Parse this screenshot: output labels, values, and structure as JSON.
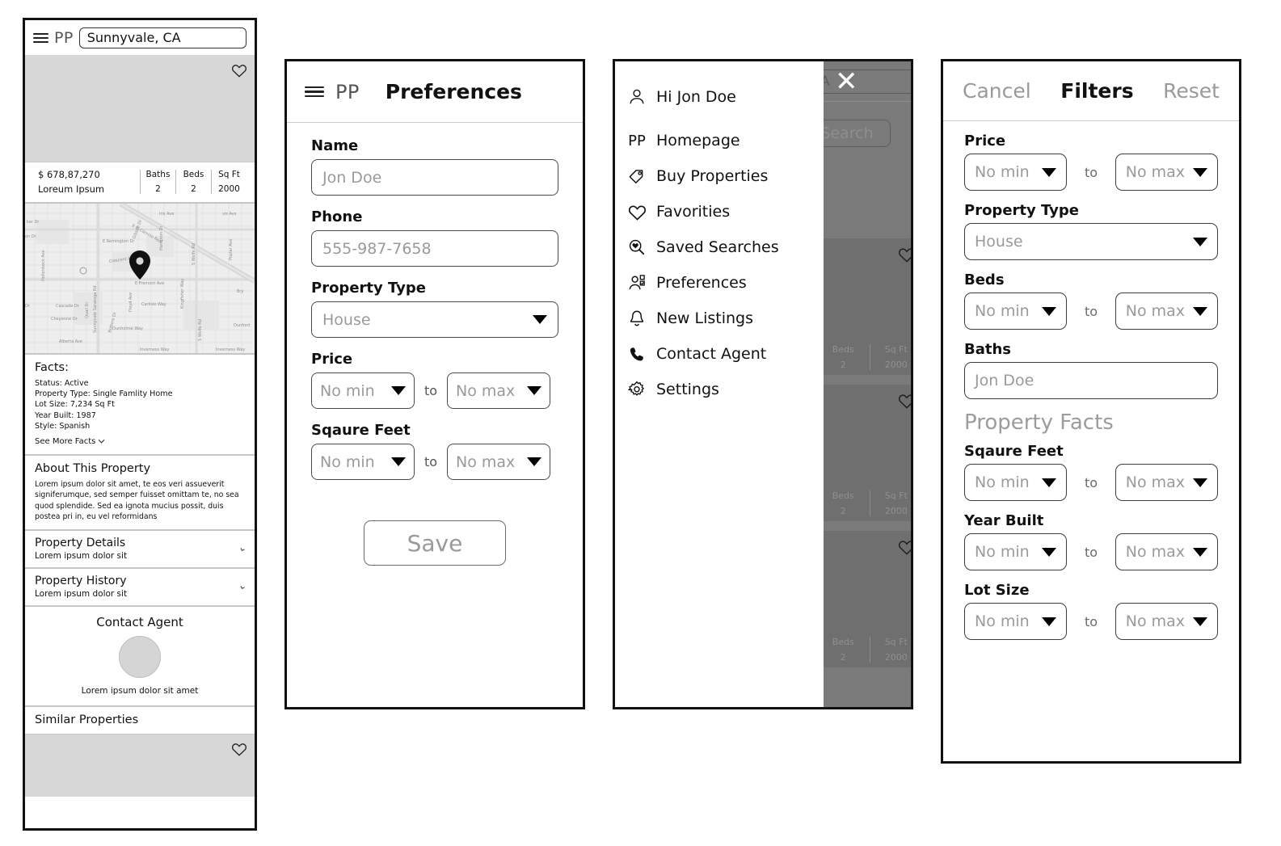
{
  "detail_panel": {
    "topbar": {
      "menu_icon": "hamburger-icon",
      "logo": "PP",
      "location_value": "Sunnyvale, CA"
    },
    "hero": {
      "favorite_icon": "heart-icon"
    },
    "listing": {
      "price": "$ 678,87,270",
      "subtitle": "Loreum Ipsum",
      "stats": [
        {
          "label": "Baths",
          "value": "2"
        },
        {
          "label": "Beds",
          "value": "2"
        },
        {
          "label": "Sq Ft",
          "value": "2000"
        }
      ]
    },
    "map": {
      "pin_icon": "map-pin-icon",
      "street_labels": [
        "E El Camino Real",
        "E Remington Dr",
        "E Fremont Ave",
        "Crescent Ave",
        "Sunnyvale Saratoga Rd",
        "Hollenbeck Ave",
        "S Wolfe Rd",
        "Cascade Dr",
        "Cheyenne Dr",
        "Alberta Ave",
        "Dunholme Way",
        "Carlisle Way",
        "Inverness Way",
        "Kingfisher Way",
        "Floyd Ave",
        "Poplar Ave",
        "Iris Ave",
        "Bottera Dr",
        "Hampton Dr",
        "Dunford Way",
        "Quail Dr"
      ]
    },
    "facts": {
      "heading": "Facts:",
      "lines": [
        "Status: Active",
        "Property Type: Single Famlity Home",
        "Lot Size:  7,234 Sq Ft",
        "Year Built: 1987",
        "Style: Spanish"
      ],
      "see_more": "See More Facts",
      "see_more_icon": "chevron-down-icon"
    },
    "about": {
      "heading": "About This Property",
      "body": "Lorem ipsum dolor sit amet, te eos veri assueverit signiferumque, sed semper fuisset omittam te, no sea quod splendide. Sed ea ignota mucius possit, duis postea pri in, eu vel reformidans"
    },
    "accordions": [
      {
        "title": "Property Details",
        "sub": "Lorem ipsum dolor sit",
        "icon": "chevron-right-icon"
      },
      {
        "title": "Property History",
        "sub": "Lorem ipsum dolor sit",
        "icon": "chevron-right-icon"
      }
    ],
    "agent": {
      "heading": "Contact Agent",
      "avatar_icon": "avatar-placeholder",
      "caption": "Lorem ipsum dolor sit amet"
    },
    "similar": {
      "heading": "Similar Properties",
      "favorite_icon": "heart-icon"
    }
  },
  "preferences_panel": {
    "topbar": {
      "menu_icon": "hamburger-icon",
      "logo": "PP",
      "title": "Preferences"
    },
    "fields": [
      {
        "label": "Name",
        "placeholder": "Jon Doe",
        "type": "text"
      },
      {
        "label": "Phone",
        "placeholder": "555-987-7658",
        "type": "text"
      },
      {
        "label": "Property Type",
        "value": "House",
        "type": "select"
      }
    ],
    "ranges": [
      {
        "label": "Price",
        "min": "No min",
        "max": "No max",
        "sep": "to"
      },
      {
        "label": "Sqaure Feet",
        "min": "No min",
        "max": "No max",
        "sep": "to"
      }
    ],
    "save_label": "Save"
  },
  "menu_panel": {
    "close_icon": "close-icon",
    "items": [
      {
        "label": "Hi Jon Doe",
        "icon": "user-icon"
      },
      {
        "label": "Homepage",
        "icon": "pp-text-logo",
        "prefix": "PP"
      },
      {
        "label": "Buy Properties",
        "icon": "tag-icon"
      },
      {
        "label": "Favorities",
        "icon": "heart-icon"
      },
      {
        "label": "Saved Searches",
        "icon": "saved-search-icon"
      },
      {
        "label": "Preferences",
        "icon": "user-settings-icon"
      },
      {
        "label": "New Listings",
        "icon": "bell-icon"
      },
      {
        "label": "Contact Agent",
        "icon": "phone-icon"
      },
      {
        "label": "Settings",
        "icon": "gear-icon"
      }
    ],
    "background": {
      "location_value": "A",
      "search_label": "Search",
      "cards": [
        {
          "favorite_icon": "heart-icon",
          "stats": [
            {
              "label": "Beds",
              "value": "2"
            },
            {
              "label": "Sq Ft",
              "value": "2000"
            }
          ]
        },
        {
          "favorite_icon": "heart-icon",
          "stats": [
            {
              "label": "Beds",
              "value": "2"
            },
            {
              "label": "Sq Ft",
              "value": "2000"
            }
          ]
        },
        {
          "favorite_icon": "heart-icon",
          "stats": [
            {
              "label": "Beds",
              "value": "2"
            },
            {
              "label": "Sq Ft",
              "value": "2000"
            }
          ]
        }
      ]
    }
  },
  "filters_panel": {
    "topbar": {
      "cancel": "Cancel",
      "title": "Filters",
      "reset": "Reset"
    },
    "price": {
      "label": "Price",
      "min": "No min",
      "max": "No max",
      "sep": "to"
    },
    "property_type": {
      "label": "Property Type",
      "value": "House"
    },
    "beds": {
      "label": "Beds",
      "min": "No min",
      "max": "No max",
      "sep": "to"
    },
    "baths": {
      "label": "Baths",
      "placeholder": "Jon Doe"
    },
    "section_title": "Property Facts",
    "facts": [
      {
        "label": "Sqaure Feet",
        "min": "No min",
        "max": "No max",
        "sep": "to"
      },
      {
        "label": "Year Built",
        "min": "No min",
        "max": "No max",
        "sep": "to"
      },
      {
        "label": "Lot Size",
        "min": "No min",
        "max": "No max",
        "sep": "to"
      }
    ]
  },
  "colors": {
    "panel_border": "#111111",
    "placeholder": "#9a9a9a",
    "image_placeholder": "#d7d7d7",
    "dim_overlay": "#7a7a7a",
    "divider": "#c6c6c6"
  }
}
